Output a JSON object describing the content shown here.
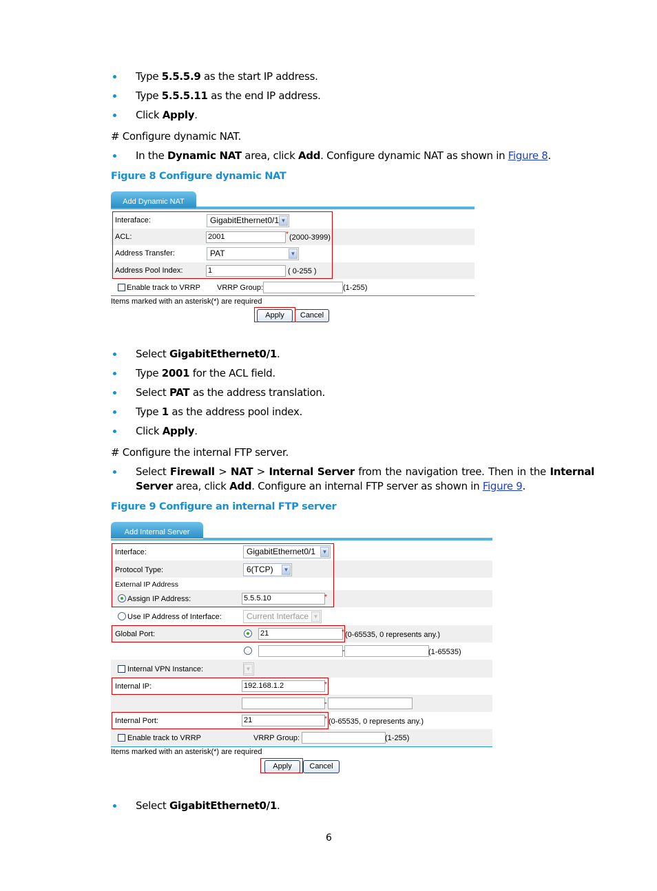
{
  "steps_top": [
    {
      "pre": "Type ",
      "bold": "5.5.5.9",
      "post": " as the start IP address."
    },
    {
      "pre": "Type ",
      "bold": "5.5.5.11",
      "post": " as the end IP address."
    },
    {
      "pre": "Click ",
      "bold": "Apply",
      "post": "."
    }
  ],
  "comment1": "# Configure dynamic NAT.",
  "step_dynamic": {
    "pre": "In the ",
    "b1": "Dynamic NAT",
    "mid": " area, click ",
    "b2": "Add",
    "post": ". Configure dynamic NAT as shown in ",
    "link": "Figure 8",
    "end": "."
  },
  "figure8": {
    "caption": "Figure 8 Configure dynamic NAT",
    "tab": "Add Dynamic NAT",
    "interface_label": "Interaface:",
    "interface_value": "GigabitEthernet0/1",
    "acl_label": "ACL:",
    "acl_value": "2001",
    "acl_hint": "(2000-3999)",
    "transfer_label": "Address Transfer:",
    "transfer_value": "PAT",
    "pool_label": "Address Pool Index:",
    "pool_value": "1",
    "pool_hint": "( 0-255 )",
    "vrrp_label": "Enable track to VRRP",
    "vrrp_group_label": "VRRP Group:",
    "vrrp_group_value": "",
    "vrrp_hint": "(1-255)",
    "required_note": "Items marked with an asterisk(*) are required",
    "apply": "Apply",
    "cancel": "Cancel"
  },
  "steps_mid": [
    {
      "pre": "Select ",
      "bold": "GigabitEthernet0/1",
      "post": "."
    },
    {
      "pre": "Type ",
      "bold": "2001",
      "post": " for the ACL field."
    },
    {
      "pre": "Select ",
      "bold": "PAT",
      "post": " as the address translation."
    },
    {
      "pre": "Type ",
      "bold": "1",
      "post": " as the address pool index."
    },
    {
      "pre": "Click ",
      "bold": "Apply",
      "post": "."
    }
  ],
  "comment2": "# Configure the internal FTP server.",
  "step_ftp": {
    "line1": {
      "pre": "Select ",
      "b1": "Firewall",
      "s1": " > ",
      "b2": "NAT",
      "s2": " > ",
      "b3": "Internal Server",
      "mid": " from the navigation tree. Then in the ",
      "b4": "Internal"
    },
    "line2": {
      "b1": "Server",
      "mid": " area, click ",
      "b2": "Add",
      "post": ". Configure an internal FTP server as shown in ",
      "link": "Figure 9",
      "end": "."
    }
  },
  "figure9": {
    "caption": "Figure 9 Configure an internal FTP server",
    "tab": "Add Internal Server",
    "interface_label": "Interface:",
    "interface_value": "GigabitEthernet0/1",
    "protocol_label": "Protocol Type:",
    "protocol_value": "6(TCP)",
    "external_ip_label": "External IP Address",
    "assign_ip_label": "Assign IP Address:",
    "assign_ip_value": "5.5.5.10",
    "use_if_label": "Use IP Address of Interface:",
    "use_if_value": "Current Interface",
    "global_port_label": "Global Port:",
    "global_port_value": "21",
    "global_port_hint": "(0-65535, 0 represents any.)",
    "global_range_hint": "(1-65535)",
    "vpn_label": "Internal VPN Instance:",
    "internal_ip_label": "Internal IP:",
    "internal_ip_value": "192.168.1.2",
    "internal_port_label": "Internal Port:",
    "internal_port_value": "21",
    "internal_port_hint": "(0-65535, 0 represents any.)",
    "vrrp_label": "Enable track to VRRP",
    "vrrp_group_label": "VRRP Group:",
    "vrrp_hint": "(1-255)",
    "required_note": "Items marked with an asterisk(*) are required",
    "apply": "Apply",
    "cancel": "Cancel"
  },
  "steps_bottom": [
    {
      "pre": "Select ",
      "bold": "GigabitEthernet0/1",
      "post": "."
    }
  ],
  "page_number": "6",
  "colors": {
    "accent": "#1a8fd0",
    "highlight_box": "#e00000",
    "link": "#1a3fd0"
  }
}
